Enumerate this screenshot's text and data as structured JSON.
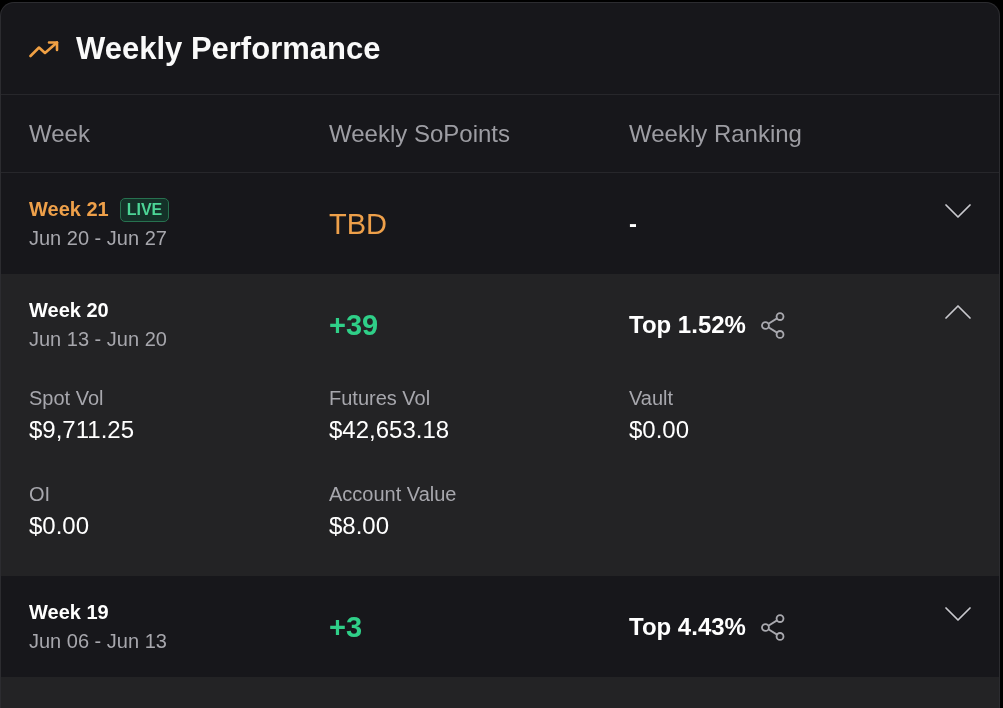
{
  "header": {
    "title": "Weekly Performance"
  },
  "columns": [
    "Week",
    "Weekly SoPoints",
    "Weekly Ranking"
  ],
  "rows": [
    {
      "week": "Week 21",
      "live": true,
      "badge": "LIVE",
      "dates": "Jun 20 - Jun 27",
      "points": "TBD",
      "pending": true,
      "ranking": "-",
      "shareable": false,
      "expanded": false
    },
    {
      "week": "Week 20",
      "live": false,
      "dates": "Jun 13 - Jun 20",
      "points": "+39",
      "pending": false,
      "ranking": "Top 1.52%",
      "shareable": true,
      "expanded": true,
      "details": [
        {
          "label": "Spot Vol",
          "value": "$9,711.25"
        },
        {
          "label": "Futures Vol",
          "value": "$42,653.18"
        },
        {
          "label": "Vault",
          "value": "$0.00"
        },
        {
          "label": "OI",
          "value": "$0.00"
        },
        {
          "label": "Account Value",
          "value": "$8.00"
        }
      ]
    },
    {
      "week": "Week 19",
      "live": false,
      "dates": "Jun 06 - Jun 13",
      "points": "+3",
      "pending": false,
      "ranking": "Top 4.43%",
      "shareable": true,
      "expanded": false
    }
  ]
}
